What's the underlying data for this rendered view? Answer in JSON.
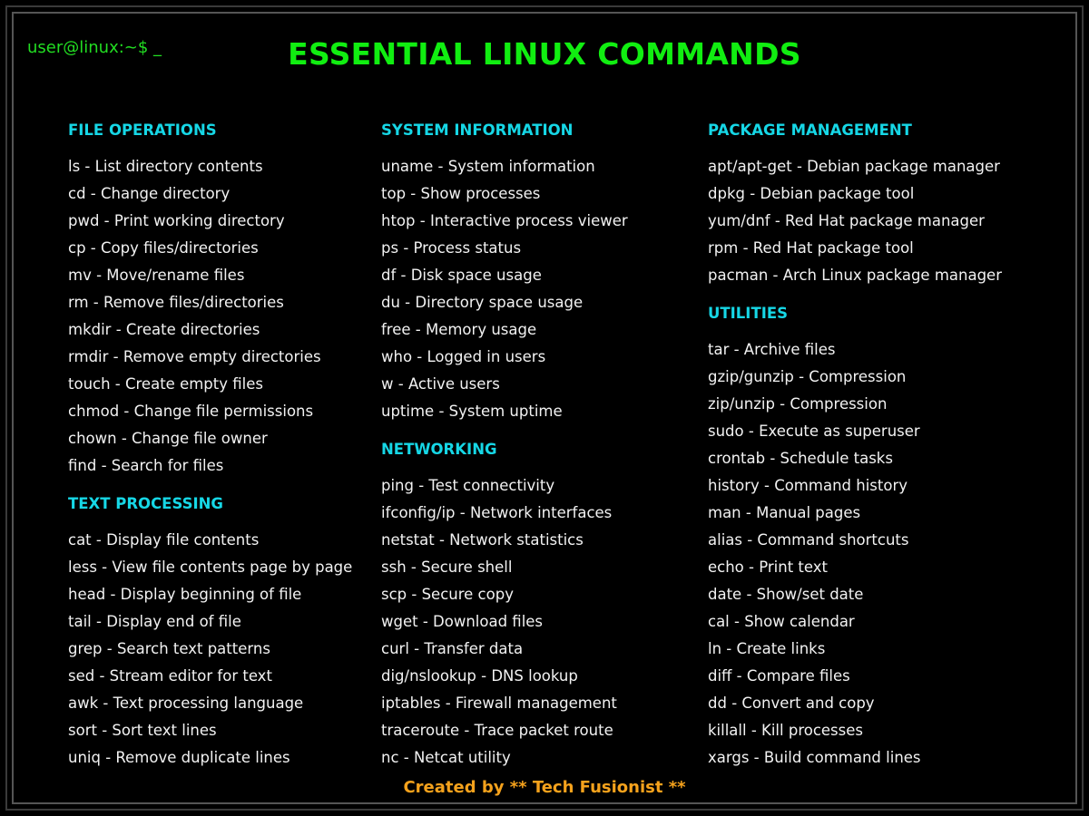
{
  "prompt": "user@linux:~$ _",
  "title": "ESSENTIAL LINUX COMMANDS",
  "columns": [
    {
      "sections": [
        {
          "heading": "FILE OPERATIONS",
          "items": [
            "ls - List directory contents",
            "cd - Change directory",
            "pwd - Print working directory",
            "cp - Copy files/directories",
            "mv - Move/rename files",
            "rm - Remove files/directories",
            "mkdir - Create directories",
            "rmdir - Remove empty directories",
            "touch - Create empty files",
            "chmod - Change file permissions",
            "chown - Change file owner",
            "find - Search for files"
          ]
        },
        {
          "heading": "TEXT PROCESSING",
          "items": [
            "cat - Display file contents",
            "less - View file contents page by page",
            "head - Display beginning of file",
            "tail - Display end of file",
            "grep - Search text patterns",
            "sed - Stream editor for text",
            "awk - Text processing language",
            "sort - Sort text lines",
            "uniq - Remove duplicate lines"
          ]
        }
      ]
    },
    {
      "sections": [
        {
          "heading": "SYSTEM INFORMATION",
          "items": [
            "uname - System information",
            "top - Show processes",
            "htop - Interactive process viewer",
            "ps - Process status",
            "df - Disk space usage",
            "du - Directory space usage",
            "free - Memory usage",
            "who - Logged in users",
            "w - Active users",
            "uptime - System uptime"
          ]
        },
        {
          "heading": "NETWORKING",
          "items": [
            "ping - Test connectivity",
            "ifconfig/ip - Network interfaces",
            "netstat - Network statistics",
            "ssh - Secure shell",
            "scp - Secure copy",
            "wget - Download files",
            "curl - Transfer data",
            "dig/nslookup - DNS lookup",
            "iptables - Firewall management",
            "traceroute - Trace packet route",
            "nc - Netcat utility"
          ]
        }
      ]
    },
    {
      "sections": [
        {
          "heading": "PACKAGE MANAGEMENT",
          "items": [
            "apt/apt-get - Debian package manager",
            "dpkg - Debian package tool",
            "yum/dnf - Red Hat package manager",
            "rpm - Red Hat package tool",
            "pacman - Arch Linux package manager"
          ]
        },
        {
          "heading": "UTILITIES",
          "items": [
            "tar - Archive files",
            "gzip/gunzip - Compression",
            "zip/unzip - Compression",
            "sudo - Execute as superuser",
            "crontab - Schedule tasks",
            "history - Command history",
            "man - Manual pages",
            "alias - Command shortcuts",
            "echo - Print text",
            "date - Show/set date",
            "cal - Show calendar",
            "ln - Create links",
            "diff - Compare files",
            "dd - Convert and copy",
            "killall - Kill processes",
            "xargs - Build command lines"
          ]
        }
      ]
    }
  ],
  "footer": "Created by ** Tech Fusionist **",
  "colors": {
    "background": "#000000",
    "title": "#11ee11",
    "prompt": "#22dd22",
    "heading": "#16d7e6",
    "text": "#f2f2f2",
    "footer": "#f5a21c"
  }
}
